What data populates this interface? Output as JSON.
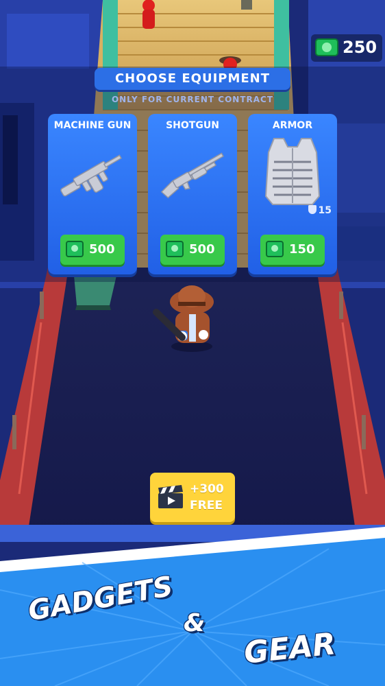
{
  "hud": {
    "cash": "250"
  },
  "header": {
    "title": "CHOOSE EQUIPMENT",
    "subtitle": "ONLY FOR CURRENT CONTRACT"
  },
  "shop": {
    "items": [
      {
        "name": "MACHINE GUN",
        "price": "500",
        "icon": "machine-gun-icon"
      },
      {
        "name": "SHOTGUN",
        "price": "500",
        "icon": "shotgun-icon"
      },
      {
        "name": "ARMOR",
        "price": "150",
        "icon": "armor-vest-icon",
        "armor_value": "15"
      }
    ]
  },
  "ad": {
    "reward": "+300",
    "label": "FREE",
    "icon": "video-clapper-icon"
  },
  "banner": {
    "word1": "GADGETS",
    "word2": "&",
    "word3": "GEAR"
  },
  "colors": {
    "card_blue": "#2f73f0",
    "buy_green": "#38c94a",
    "ad_yellow": "#ffd43b",
    "banner_blue": "#2a8ff0"
  }
}
